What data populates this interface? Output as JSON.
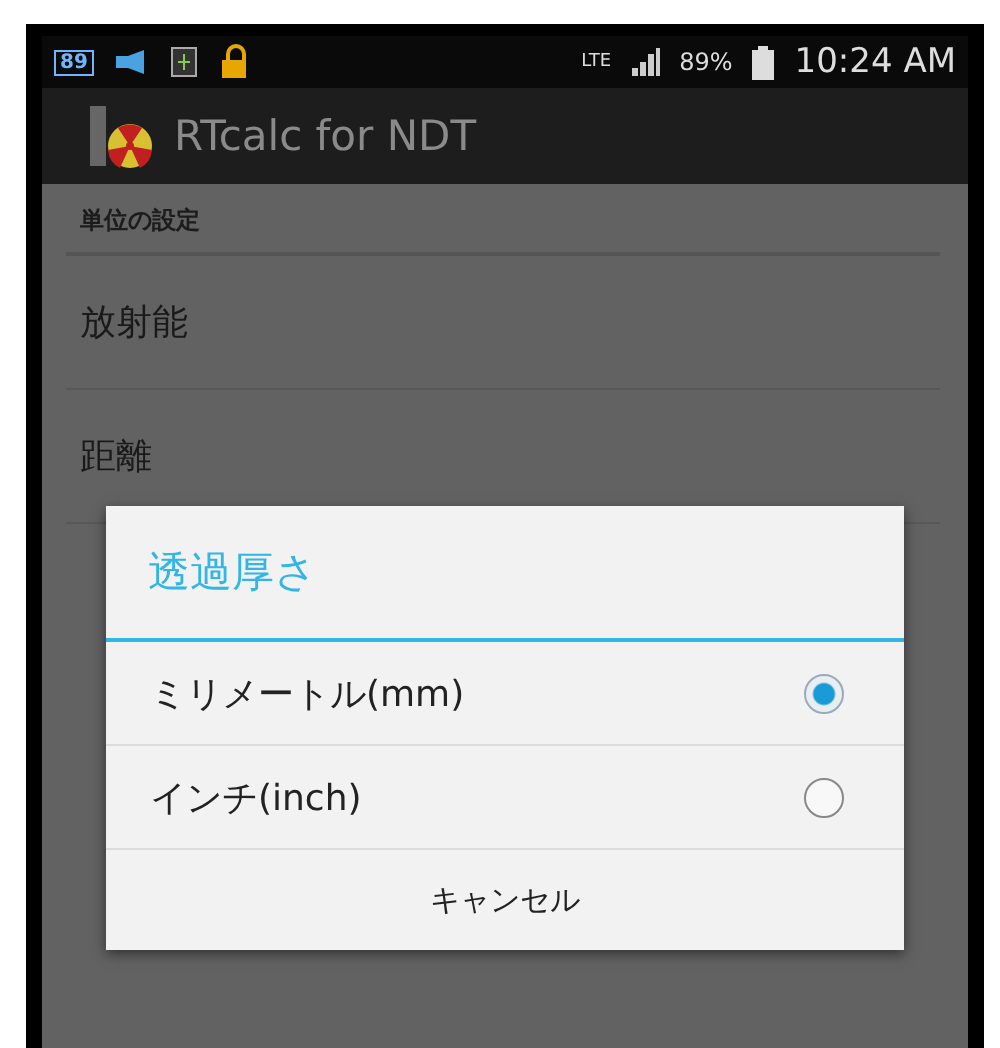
{
  "status_bar": {
    "badge": "89",
    "network": "LTE",
    "battery": "89%",
    "time": "10:24 AM"
  },
  "app_bar": {
    "title": "RTcalc for NDT"
  },
  "settings": {
    "section": "単位の設定",
    "items": [
      "放射能",
      "距離"
    ]
  },
  "dialog": {
    "title": "透過厚さ",
    "options": [
      {
        "label": "ミリメートル(mm)",
        "selected": true
      },
      {
        "label": "インチ(inch)",
        "selected": false
      }
    ],
    "cancel": "キャンセル"
  }
}
